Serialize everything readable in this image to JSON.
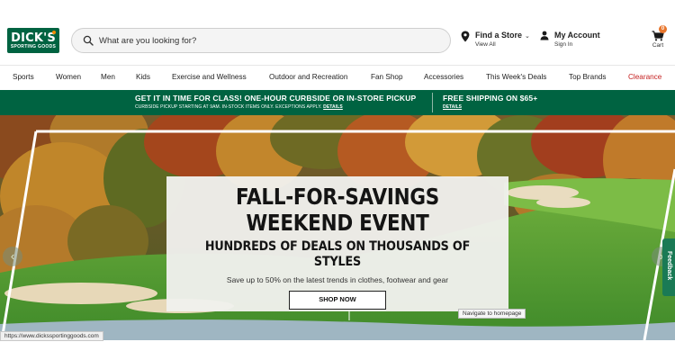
{
  "brand": {
    "logo_main": "DICK'S",
    "logo_sub": "SPORTING GOODS",
    "color_green": "#006341",
    "color_orange": "#f38b00"
  },
  "header": {
    "search_placeholder": "What are you looking for?",
    "store_title": "Find a Store",
    "store_sub": "View All",
    "account_title": "My Account",
    "account_sub": "Sign In",
    "cart_label": "Cart",
    "cart_count": "0"
  },
  "nav": {
    "items": [
      "Sports",
      "Women",
      "Men",
      "Kids",
      "Exercise and Wellness",
      "Outdoor and Recreation",
      "Fan Shop",
      "Accessories",
      "This Week's Deals",
      "Top Brands",
      "Clearance"
    ],
    "clearance_color": "#c41e1e"
  },
  "promo": {
    "left_title": "GET IT IN TIME FOR CLASS! ONE-HOUR CURBSIDE OR IN-STORE PICKUP",
    "left_sub": "CURBSIDE PICKUP STARTING AT 9AM. IN-STOCK ITEMS ONLY. EXCEPTIONS APPLY.",
    "left_details": "DETAILS",
    "right_title": "FREE SHIPPING ON $65+",
    "right_details": "DETAILS"
  },
  "hero": {
    "headline_line1": "FALL-FOR-SAVINGS",
    "headline_line2": "WEEKEND EVENT",
    "subheadline": "HUNDREDS OF DEALS ON THOUSANDS OF STYLES",
    "body": "Save up to 50% on the latest trends in clothes, footwear and gear",
    "cta": "SHOP NOW",
    "prev_arrow": "‹",
    "next_arrow": "›"
  },
  "feedback_label": "Feedback",
  "tooltip": "Navigate to homepage",
  "status_url": "https://www.dickssportinggoods.com"
}
